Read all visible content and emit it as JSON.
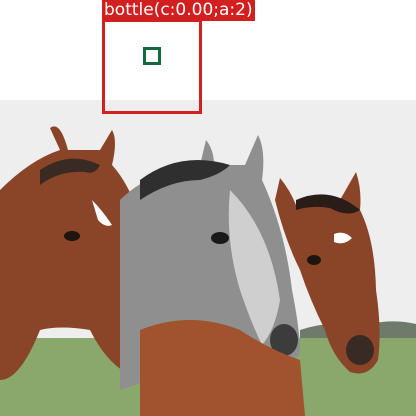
{
  "image": {
    "subject": "three horses",
    "colors": {
      "sky": "#f2f2f2",
      "grass": "#8aa86b",
      "bay": "#8a4427",
      "gray": "#8f8f8f"
    }
  },
  "detection": {
    "label": "bottle(c:0.00;a:2)",
    "box_color": "#d21f1f",
    "point_color": "#0f6b3d"
  }
}
